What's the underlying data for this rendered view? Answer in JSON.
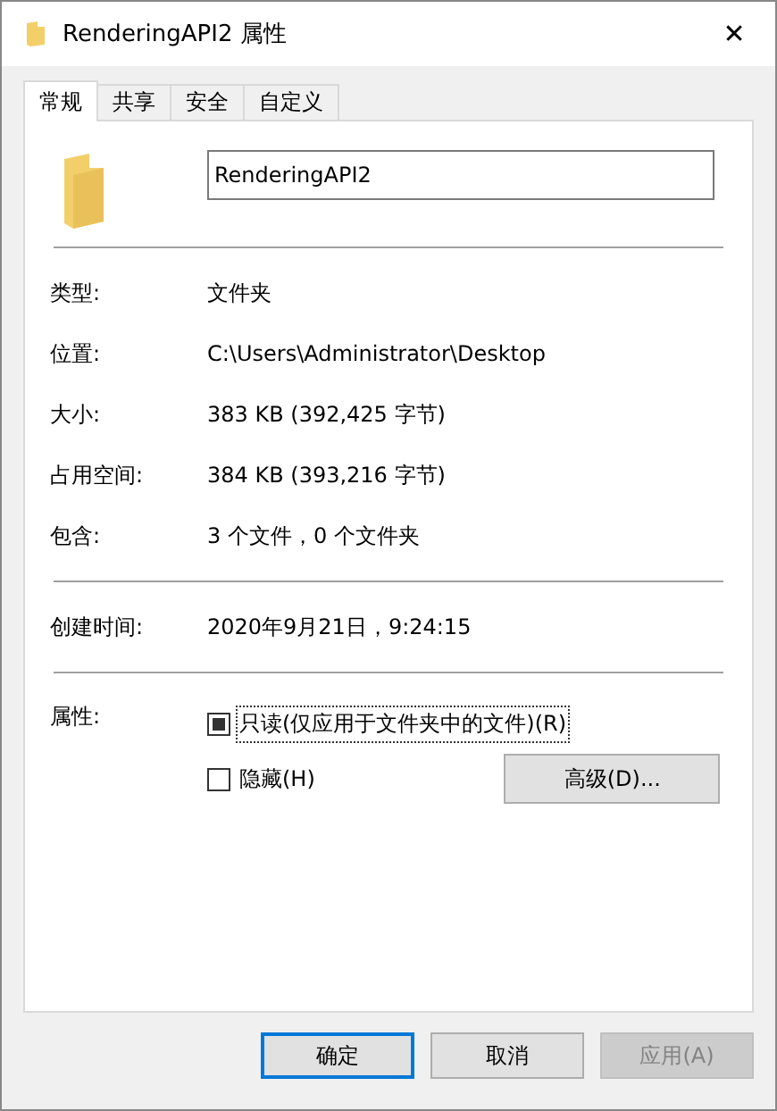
{
  "window": {
    "title": "RenderingAPI2 属性",
    "close": "✕"
  },
  "tabs": [
    {
      "label": "常规",
      "selected": true
    },
    {
      "label": "共享",
      "selected": false
    },
    {
      "label": "安全",
      "selected": false
    },
    {
      "label": "自定义",
      "selected": false
    }
  ],
  "name_field": {
    "value": "RenderingAPI2"
  },
  "groups": [
    [
      {
        "label": "类型:",
        "value": "文件夹"
      },
      {
        "label": "位置:",
        "value": "C:\\Users\\Administrator\\Desktop"
      },
      {
        "label": "大小:",
        "value": "383 KB (392,425 字节)"
      },
      {
        "label": "占用空间:",
        "value": "384 KB (393,216 字节)"
      },
      {
        "label": "包含:",
        "value": "3 个文件，0 个文件夹"
      }
    ],
    [
      {
        "label": "创建时间:",
        "value": "2020年9月21日，9:24:15"
      }
    ]
  ],
  "attributes": {
    "label": "属性:",
    "checkboxes": [
      {
        "label": "只读(仅应用于文件夹中的文件)(R)",
        "checked": false,
        "indeterminate": true,
        "focused": true
      },
      {
        "label": "隐藏(H)",
        "checked": false,
        "indeterminate": false,
        "focused": false
      }
    ],
    "advanced_button": "高级(D)..."
  },
  "buttons": [
    {
      "label": "确定",
      "default": true,
      "disabled": false
    },
    {
      "label": "取消",
      "default": false,
      "disabled": false
    },
    {
      "label": "应用(A)",
      "default": false,
      "disabled": true
    }
  ]
}
